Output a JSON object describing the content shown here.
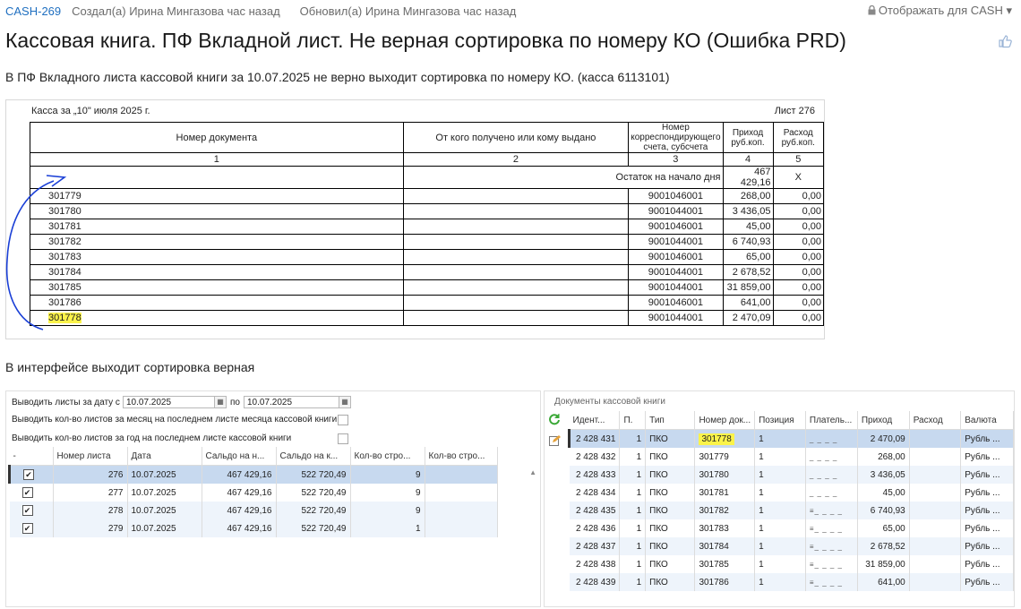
{
  "header": {
    "key": "CASH-269",
    "created": "Создал(а) Ирина Мингазова час назад",
    "updated": "Обновил(а) Ирина Мингазова час назад",
    "visibility": "Отображать для CASH"
  },
  "title": "Кассовая книга. ПФ Вкладной лист. Не верная сортировка по номеру КО (Ошибка PRD)",
  "description": "В ПФ Вкладного листа кассовой книги за 10.07.2025 не верно выходит сортировка по номеру КО. (касса 6113101)",
  "description2": "В интерфейсе выходит сортировка верная",
  "print_form": {
    "kassa": "Касса за „10\" июля 2025 г.",
    "list": "Лист  276",
    "headers": [
      "Номер документа",
      "От кого получено или кому выдано",
      "Номер корреспондирующего счета, субсчета",
      "Приход руб.коп.",
      "Расход руб.коп."
    ],
    "numbers": [
      "1",
      "2",
      "3",
      "4",
      "5"
    ],
    "opening_label": "Остаток на начало дня",
    "opening_value": "467 429,16",
    "opening_x": "X",
    "rows": [
      {
        "doc": "301779",
        "acc": "9001046001",
        "in": "268,00",
        "out": "0,00"
      },
      {
        "doc": "301780",
        "acc": "9001044001",
        "in": "3 436,05",
        "out": "0,00"
      },
      {
        "doc": "301781",
        "acc": "9001046001",
        "in": "45,00",
        "out": "0,00"
      },
      {
        "doc": "301782",
        "acc": "9001044001",
        "in": "6 740,93",
        "out": "0,00"
      },
      {
        "doc": "301783",
        "acc": "9001046001",
        "in": "65,00",
        "out": "0,00"
      },
      {
        "doc": "301784",
        "acc": "9001044001",
        "in": "2 678,52",
        "out": "0,00"
      },
      {
        "doc": "301785",
        "acc": "9001044001",
        "in": "31 859,00",
        "out": "0,00"
      },
      {
        "doc": "301786",
        "acc": "9001046001",
        "in": "641,00",
        "out": "0,00"
      },
      {
        "doc": "301778",
        "acc": "9001044001",
        "in": "2 470,09",
        "out": "0,00"
      }
    ]
  },
  "left_panel": {
    "date_from_label": "Выводить листы за дату с",
    "date_from": "10.07.2025",
    "date_to_label": "по",
    "date_to": "10.07.2025",
    "opt_month": "Выводить кол-во листов за месяц на последнем листе месяца кассовой книги",
    "opt_year": "Выводить кол-во листов за год на последнем листе кассовой книги",
    "columns": [
      "-",
      "Номер листа",
      "Дата",
      "Сальдо на н...",
      "Сальдо на к...",
      "Кол-во стро...",
      "Кол-во стро..."
    ],
    "rows": [
      {
        "num": "276",
        "date": "10.07.2025",
        "s1": "467 429,16",
        "s2": "522 720,49",
        "cnt": "9"
      },
      {
        "num": "277",
        "date": "10.07.2025",
        "s1": "467 429,16",
        "s2": "522 720,49",
        "cnt": "9"
      },
      {
        "num": "278",
        "date": "10.07.2025",
        "s1": "467 429,16",
        "s2": "522 720,49",
        "cnt": "9"
      },
      {
        "num": "279",
        "date": "10.07.2025",
        "s1": "467 429,16",
        "s2": "522 720,49",
        "cnt": "1"
      }
    ]
  },
  "right_panel": {
    "title": "Документы кассовой книги",
    "columns": [
      "Идент...",
      "П.",
      "Тип",
      "Номер док...",
      "Позиция",
      "Платель...",
      "Приход",
      "Расход",
      "Валюта"
    ],
    "rows": [
      {
        "id": "2 428 431",
        "p": "1",
        "type": "ПКО",
        "doc": "301778",
        "pos": "1",
        "payer": "_ _ _ _",
        "in": "2 470,09",
        "cur": "Рубль ..."
      },
      {
        "id": "2 428 432",
        "p": "1",
        "type": "ПКО",
        "doc": "301779",
        "pos": "1",
        "payer": "_ _ _ _",
        "in": "268,00",
        "cur": "Рубль ..."
      },
      {
        "id": "2 428 433",
        "p": "1",
        "type": "ПКО",
        "doc": "301780",
        "pos": "1",
        "payer": "_ _ _ _",
        "in": "3 436,05",
        "cur": "Рубль ..."
      },
      {
        "id": "2 428 434",
        "p": "1",
        "type": "ПКО",
        "doc": "301781",
        "pos": "1",
        "payer": "_ _ _ _",
        "in": "45,00",
        "cur": "Рубль ..."
      },
      {
        "id": "2 428 435",
        "p": "1",
        "type": "ПКО",
        "doc": "301782",
        "pos": "1",
        "payer": "≡_ _ _ _",
        "in": "6 740,93",
        "cur": "Рубль ..."
      },
      {
        "id": "2 428 436",
        "p": "1",
        "type": "ПКО",
        "doc": "301783",
        "pos": "1",
        "payer": "≡_ _ _ _",
        "in": "65,00",
        "cur": "Рубль ..."
      },
      {
        "id": "2 428 437",
        "p": "1",
        "type": "ПКО",
        "doc": "301784",
        "pos": "1",
        "payer": "≡_ _ _ _",
        "in": "2 678,52",
        "cur": "Рубль ..."
      },
      {
        "id": "2 428 438",
        "p": "1",
        "type": "ПКО",
        "doc": "301785",
        "pos": "1",
        "payer": "≡_ _ _ _",
        "in": "31 859,00",
        "cur": "Рубль ..."
      },
      {
        "id": "2 428 439",
        "p": "1",
        "type": "ПКО",
        "doc": "301786",
        "pos": "1",
        "payer": "≡_ _ _ _",
        "in": "641,00",
        "cur": "Рубль ..."
      }
    ]
  },
  "colors": {
    "highlight": "#fbf34a",
    "link": "#1f6fc0",
    "arrow": "#1a3fd6",
    "selected_row": "#c7d9ef"
  }
}
